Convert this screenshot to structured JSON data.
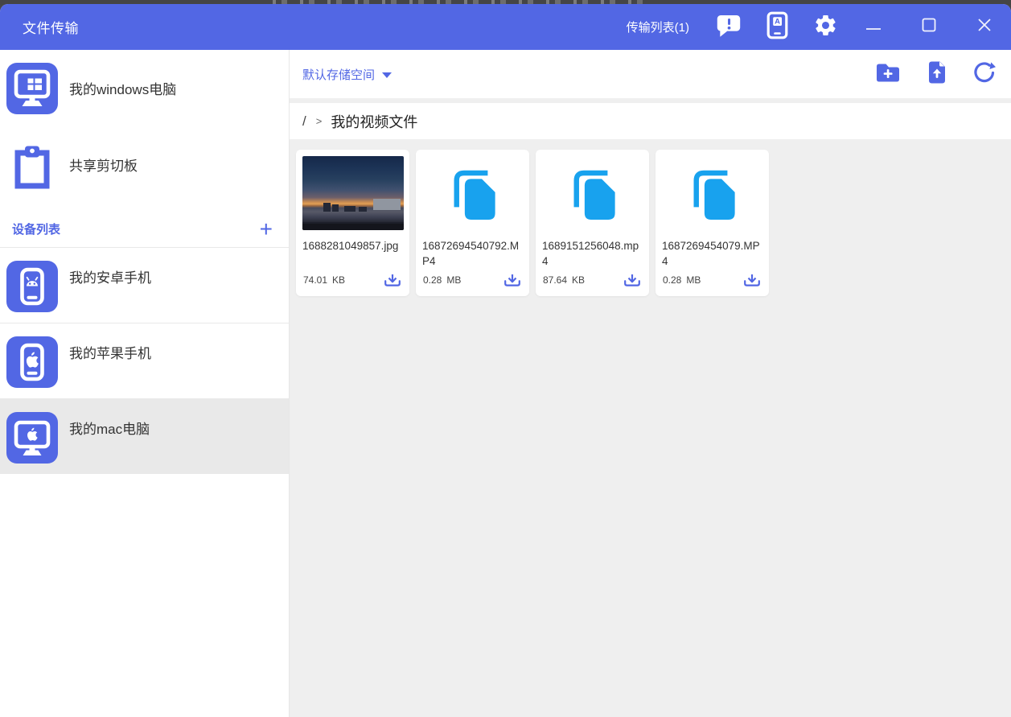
{
  "titlebar": {
    "title": "文件传输",
    "transfer_list_label": "传输列表(1)"
  },
  "sidebar": {
    "top_items": [
      {
        "label": "我的windows电脑",
        "icon": "windows-computer-icon"
      },
      {
        "label": "共享剪切板",
        "icon": "clipboard-icon"
      }
    ],
    "device_section": {
      "header": "设备列表",
      "add_label": "+"
    },
    "devices": [
      {
        "label": "我的安卓手机",
        "icon": "android-phone-icon",
        "selected": false
      },
      {
        "label": "我的苹果手机",
        "icon": "apple-phone-icon",
        "selected": false
      },
      {
        "label": "我的mac电脑",
        "icon": "mac-computer-icon",
        "selected": true
      }
    ]
  },
  "main": {
    "storage_selector": {
      "label": "默认存储空间"
    },
    "breadcrumb": {
      "root": "/",
      "separator": ">",
      "current": "我的视频文件"
    },
    "files": [
      {
        "name": "1688281049857.jpg",
        "size": "74.01",
        "unit": "KB",
        "type": "image"
      },
      {
        "name": "16872694540792.MP4",
        "size": "0.28",
        "unit": "MB",
        "type": "file"
      },
      {
        "name": "1689151256048.mp4",
        "size": "87.64",
        "unit": "KB",
        "type": "file"
      },
      {
        "name": "1687269454079.MP4",
        "size": "0.28",
        "unit": "MB",
        "type": "file"
      }
    ]
  },
  "colors": {
    "accent": "#5267e4",
    "file_icon_blue": "#18a2ee",
    "selected_row_bg": "#e9e9e9",
    "content_bg": "#efefef"
  }
}
